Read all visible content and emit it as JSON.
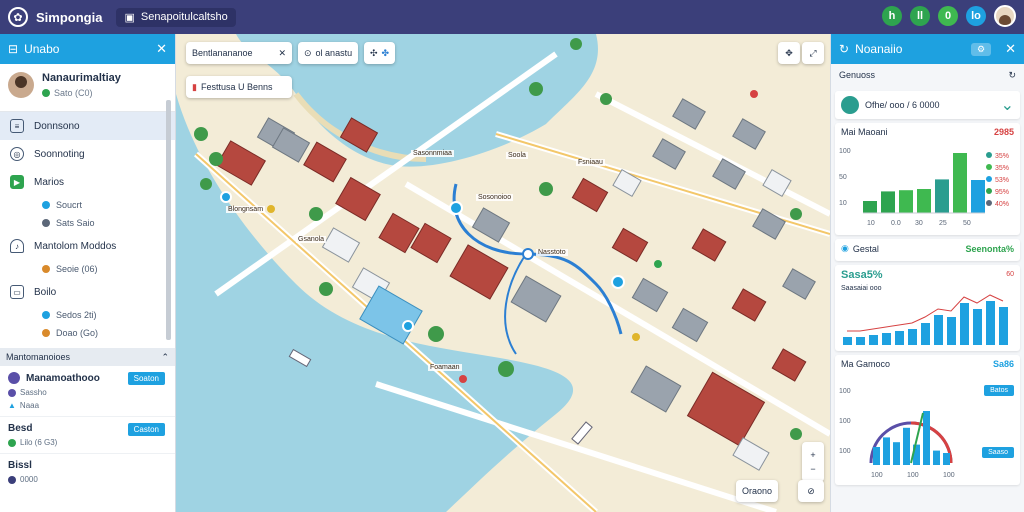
{
  "topbar": {
    "app_title": "Simpongia",
    "breadcrumb": "Senapoitulcaltsho",
    "buttons": [
      {
        "label": "h",
        "color": "#2ea44f"
      },
      {
        "label": "ll",
        "color": "#2ea44f"
      },
      {
        "label": "0",
        "color": "#3fb950"
      },
      {
        "label": "lo",
        "color": "#1ea1e0"
      }
    ]
  },
  "left": {
    "title": "Unabo",
    "profile": {
      "name": "Nanaurimaltiay",
      "status": "Sato (C0)"
    },
    "nav": [
      {
        "label": "Donnsono",
        "icon": "document-icon",
        "active": true
      },
      {
        "label": "Soonnoting",
        "icon": "settings-icon",
        "active": false
      },
      {
        "label": "Marios",
        "icon": "flag-icon",
        "active": false
      },
      {
        "label": "Mantolom Moddos",
        "icon": "hand-icon",
        "active": false
      },
      {
        "label": "Boilo",
        "icon": "document-icon",
        "active": false
      }
    ],
    "nav_sub": [
      "Soucrt",
      "Sats Saio",
      "Seoie (06)",
      "Sedos 2ti)",
      "Doao (Go)"
    ],
    "section": "Mantomanoioes",
    "tasks": [
      {
        "name": "Manamoathooo",
        "button": "Soaton",
        "sub1": "Sassho",
        "sub2": "Naaa"
      },
      {
        "name": "Besd",
        "button": "Caston",
        "sub1": "Lilo (6 G3)"
      },
      {
        "name": "Bissl",
        "sub1": "0000"
      }
    ]
  },
  "map": {
    "search_label": "Bentlanananoe",
    "tool2": "ol anastu",
    "tool3": "Festtusa U Benns",
    "labels": [
      "Sasonnmiaa",
      "Soola",
      "Fsniaau",
      "Sosonoioo",
      "Blongnsam",
      "Nasstoto",
      "Foamaan",
      "Gsanola"
    ],
    "bottom_button": "Oraono"
  },
  "right": {
    "title": "Noanaiio",
    "subtitle": "Genuoss",
    "selector": "Ofhe/ ooo / 6 0000",
    "chart1": {
      "title": "Mai Maoani",
      "value": "2985",
      "type": "bar",
      "values": [
        20,
        36,
        38,
        40,
        56,
        100,
        55
      ],
      "colors": [
        "#2ea44f",
        "#2ea44f",
        "#3fb950",
        "#3fb950",
        "#2a9d8f",
        "#3fb950",
        "#1ea1e0"
      ],
      "yticks": [
        "100",
        "50",
        "10"
      ],
      "xticks": [
        "10",
        "0.0",
        "30",
        "25",
        "50"
      ],
      "legend": [
        {
          "label": "35%",
          "color": "#2a9d8f"
        },
        {
          "label": "35%",
          "color": "#3fb950"
        },
        {
          "label": "53%",
          "color": "#1ea1e0"
        },
        {
          "label": "95%",
          "color": "#2ea44f"
        },
        {
          "label": "40%",
          "color": "#5b6778"
        }
      ]
    },
    "chart2": {
      "title": "Gestal",
      "value": "Seenonta%",
      "headline": "Sasa5%",
      "sub": "Saasaiai ooo",
      "badge": "60",
      "type": "bar",
      "values": [
        8,
        8,
        10,
        12,
        14,
        16,
        22,
        30,
        28,
        42,
        36,
        44,
        38
      ]
    },
    "chart3": {
      "title": "Ma Gamoco",
      "value": "Sa86",
      "button1": "Batos",
      "button2": "Saaso",
      "yticks": [
        "100",
        "100",
        "100"
      ],
      "xticks": [
        "100",
        "100",
        "100"
      ],
      "type": "bar",
      "values": [
        30,
        46,
        38,
        62,
        34,
        90,
        24,
        20
      ]
    }
  }
}
